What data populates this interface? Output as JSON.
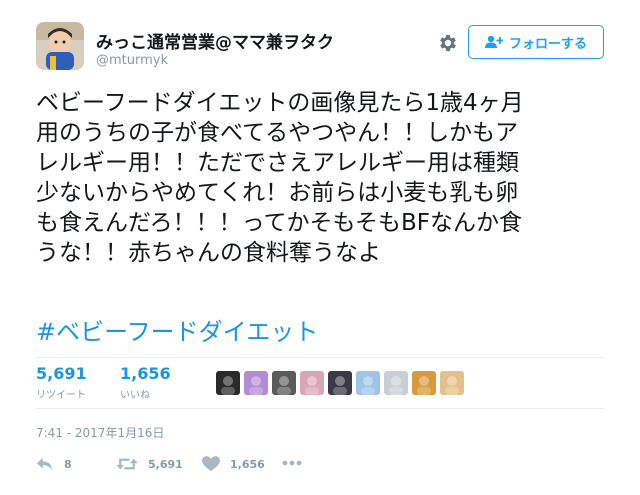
{
  "user": {
    "display_name": "みっこ通常営業@ママ兼ヲタク",
    "handle": "@mturmyk",
    "avatar_icon": "child-avatar-photo"
  },
  "header": {
    "settings_icon": "gear-icon",
    "follow_label": "フォローする",
    "follow_icon": "add-user-icon"
  },
  "tweet": {
    "lines": [
      "ベビーフードダイエットの画像見たら1歳4ヶ月",
      "用のうちの子が食べてるやつやん！！しかもア",
      "レルギー用！！ただでさえアレルギー用は種類",
      "少ないからやめてくれ！お前らは小麦も乳も卵",
      "も食えんだろ！！！ってかそもそもBFなんか食",
      "うな！！赤ちゃんの食料奪うなよ"
    ],
    "hashtag": "#ベビーフードダイエット"
  },
  "stats": {
    "retweets": {
      "count": "5,691",
      "label": "リツイート"
    },
    "likes": {
      "count": "1,656",
      "label": "いいね"
    }
  },
  "liker_avatars": [
    {
      "name": "liker-avatar-1",
      "color": "#2a2a2a"
    },
    {
      "name": "liker-avatar-2",
      "color": "#b48ad6"
    },
    {
      "name": "liker-avatar-3",
      "color": "#5a5a5a"
    },
    {
      "name": "liker-avatar-4",
      "color": "#d9a6b8"
    },
    {
      "name": "liker-avatar-5",
      "color": "#3b3a44"
    },
    {
      "name": "liker-avatar-6",
      "color": "#9fc4e8"
    },
    {
      "name": "liker-avatar-7",
      "color": "#c9cfd6"
    },
    {
      "name": "liker-avatar-8",
      "color": "#d89a3c"
    },
    {
      "name": "liker-avatar-9",
      "color": "#e3c08a"
    }
  ],
  "timestamp": "7:41 - 2017年1月16日",
  "actions": {
    "reply": {
      "icon": "reply-icon",
      "count": "8"
    },
    "retweet": {
      "icon": "retweet-icon",
      "count": "5,691"
    },
    "like": {
      "icon": "heart-icon",
      "count": "1,656"
    },
    "more": {
      "icon": "more-icon"
    }
  },
  "colors": {
    "link": "#1b95e0",
    "muted": "#8899a6",
    "text": "#14171a",
    "divider": "#e6ecf0"
  }
}
